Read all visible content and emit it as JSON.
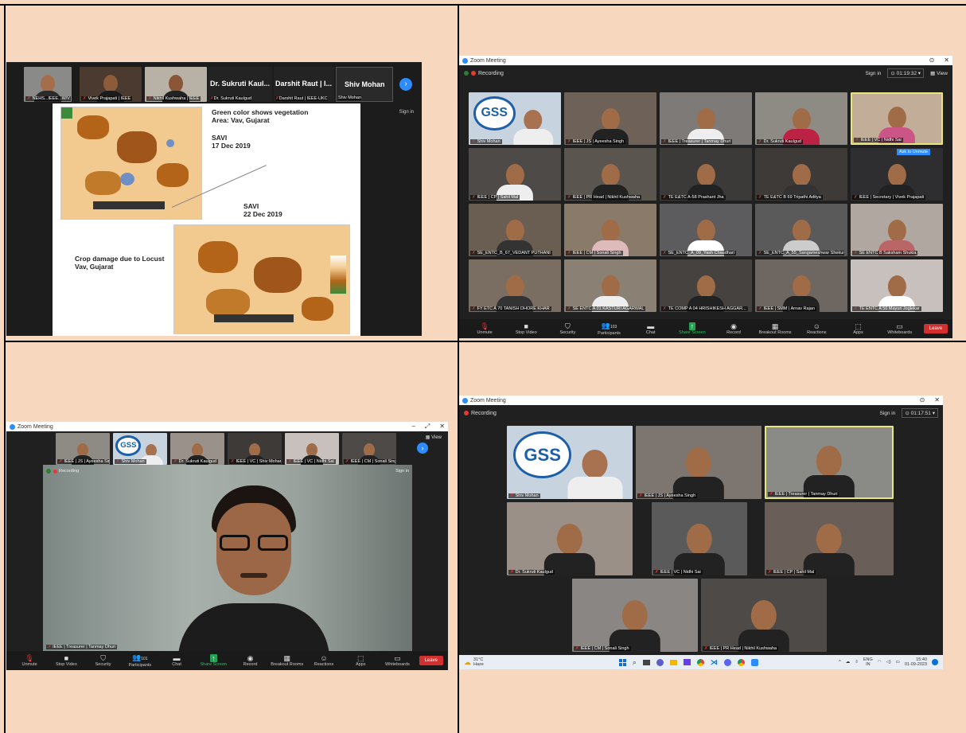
{
  "colors": {
    "sheet_bg": "#f8d7bf",
    "zoom_bg": "#202020",
    "leave": "#d32f2f",
    "share_green": "#23a455",
    "gss_blue": "#1d5fa8",
    "active_border": "#e6e67a"
  },
  "panel1": {
    "strip_names": [
      "NEHS...IEEE...W/V",
      "Vivek Prajapati | IEEE",
      "Nikhil Kushwaha | IEEE",
      "Dr. Sukruti Kaulgud",
      "Darshit Raut | IEEE-UKC",
      "Shiv Mohan"
    ],
    "big_names": [
      "Dr. Sukruti Kaul...",
      "Darshit Raut | I...",
      "Shiv Mohan"
    ],
    "slide": {
      "line1": "Green color shows vegetation",
      "line2": "Area: Vav, Gujarat",
      "savi1": "SAVI",
      "date1": "17 Dec 2019",
      "savi2": "SAVI",
      "date2": "22 Dec 2019",
      "crop1": "Crop damage due to Locust",
      "crop2": "Vav, Gujarat"
    },
    "sign_in": "Sign in"
  },
  "panel2": {
    "title": "Zoom Meeting",
    "recording": "Recording",
    "sign_in": "Sign in",
    "timer": "01:19:32",
    "view": "View",
    "ask_unmute": "Ask to Unmute",
    "tiles": [
      "Shiv Mohan",
      "IEEE | JS | Ayeesha Singh",
      "IEEE | Treasurer | Tanmay Dhuri",
      "Dr. Sukruti Kaulgud",
      "IEEE | VC | Nidhi Sai",
      "IEEE | CP | Sahil Mal",
      "IEEE | PR Head | Nikhil Kushwaha",
      "TE E&TC A-58 Prashant Jha",
      "TE E&TC B 69 Tripathi Aditya",
      "IEEE | Secretary | Vivek Prajapati",
      "SE_ENTC_B_67_VEDANT PUTHANI",
      "IEEE | CM | Sonali Singh",
      "SE_ENTC_A_09_Yash Chaudhari",
      "SE_ENTC_A_55_Sangameshwar Shekumi",
      "SE ENTC B Saksham Shukla",
      "FY ETC A 70 TANISH DHORE KHAR",
      "SE ENTC A 01 KASTURI AGARWAL",
      "TE COMP A 04 HRISHIKESH AGGAR...",
      "IEEE | SMM | Arnav Rajan",
      "TE ENTC A 56 Mayuri Joglekar"
    ],
    "toolbar": [
      "Unmute",
      "Stop Video",
      "Security",
      "Participants",
      "Chat",
      "Share Screen",
      "Record",
      "Breakout Rooms",
      "Reactions",
      "Apps",
      "Whiteboards"
    ],
    "participants_count": "103",
    "leave": "Leave"
  },
  "panel3": {
    "title": "Zoom Meeting",
    "view": "View",
    "strip_names": [
      "IEEE | JS | Ayeesha Sin...",
      "Shiv Mohan",
      "Dr. Sukruti Kaulgud",
      "IEEE | VC | Shiv Mohan",
      "IEEE | VC | Nidhi Sai",
      "IEEE | CM | Sonali Singh"
    ],
    "recording": "Recording",
    "sign_in": "Sign in",
    "speaker_name": "IEEE | Treasurer | Tanmay Dhuri",
    "toolbar": [
      "Unmute",
      "Stop Video",
      "Security",
      "Participants",
      "Chat",
      "Share Screen",
      "Record",
      "Breakout Rooms",
      "Reactions",
      "Apps",
      "Whiteboards"
    ],
    "participants_count": "101",
    "leave": "Leave"
  },
  "panel4": {
    "title": "Zoom Meeting",
    "recording": "Recording",
    "sign_in": "Sign in",
    "timer": "01:17:51",
    "tiles": [
      "Shiv Mohan",
      "IEEE | JS | Ayeesha Singh",
      "IEEE | Treasurer | Tanmay Dhuri",
      "Dr. Sukruti Kaulgud",
      "IEEE | VC | Nidhi Sai",
      "IEEE | CP | Sahil Mal",
      "IEEE | CM | Sonali Singh",
      "IEEE | PR Head | Nikhil Kushwaha"
    ],
    "weather_temp": "31°C",
    "weather_text": "Haze",
    "lang": "ENG",
    "lang2": "IN",
    "time": "15:40",
    "date": "01-09-2023"
  }
}
